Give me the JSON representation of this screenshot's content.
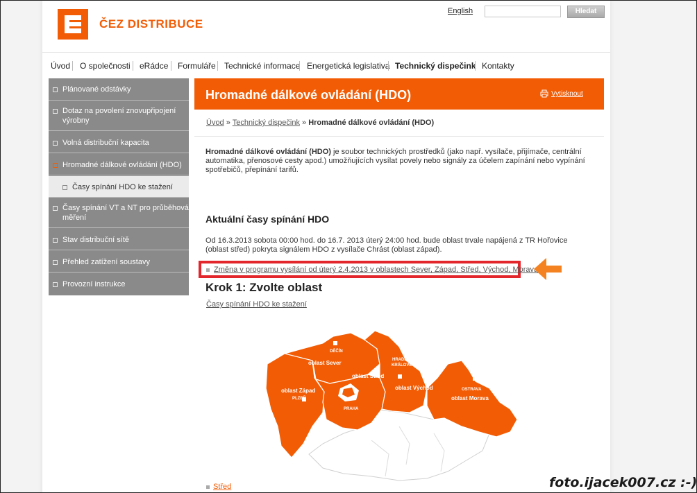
{
  "header": {
    "brand": "ČEZ DISTRIBUCE",
    "english_link": "English",
    "search_placeholder": "",
    "search_button": "Hledat"
  },
  "nav": {
    "items": [
      {
        "label": "Úvod"
      },
      {
        "label": "O společnosti"
      },
      {
        "label": "eRádce"
      },
      {
        "label": "Formuláře"
      },
      {
        "label": "Technické informace"
      },
      {
        "label": "Energetická legislativa"
      },
      {
        "label": "Technický dispečink"
      },
      {
        "label": "Kontakty"
      }
    ],
    "active": "Technický dispečink"
  },
  "sidebar": {
    "items": [
      {
        "label": "Plánované odstávky"
      },
      {
        "label": "Dotaz na povolení znovupřipojení výrobny"
      },
      {
        "label": "Volná distribuční kapacita"
      },
      {
        "label": "Hromadné dálkové ovládání (HDO)"
      },
      {
        "label": "Časy spínání HDO ke stažení"
      },
      {
        "label": "Časy spínání VT a NT pro průběhová měření"
      },
      {
        "label": "Stav distribuční sítě"
      },
      {
        "label": "Přehled zatížení soustavy"
      },
      {
        "label": "Provozní instrukce"
      }
    ]
  },
  "content": {
    "title": "Hromadné dálkové ovládání (HDO)",
    "print_label": "Vytisknout",
    "breadcrumb": {
      "home": "Úvod",
      "sep": "»",
      "section": "Technický dispečink",
      "current": "Hromadné dálkové ovládání (HDO)"
    },
    "intro_bold": "Hromadné dálkové ovládání (HDO)",
    "intro_text": " je soubor technických prostředků (jako např. vysílače, přijímače, centrální automatika, přenosové cesty apod.) umožňujících vysílat povely nebo signály za účelem zapínání nebo vypínání spotřebičů, přepínání tarifů.",
    "section_heading": "Aktuální časy spínání HDO",
    "notice": "Od  16.3.2013 sobota  00:00 hod.  do 16.7. 2013 úterý  24:00 hod. bude oblast  trvale napájená  z TR Hořovice (oblast střed)  pokryta signálem HDO z vysílače Chrást (oblast západ).",
    "change_link": "Změna v programu vysílání od úterý 2.4.2013 v oblastech Sever, Západ, Střed, Východ, Morava",
    "step_heading": "Krok 1: Zvolte oblast",
    "download_link": "Časy spínání HDO ke stažení",
    "region_link": "Střed"
  },
  "map": {
    "regions": {
      "sever": "oblast Sever",
      "zapad": "oblast Západ",
      "stred": "oblast Střed",
      "vychod": "oblast Východ",
      "morava": "oblast Morava"
    },
    "cities": {
      "decin": "DĚČÍN",
      "hradec": "HRADEC",
      "kralove": "KRÁLOVÉ",
      "praha": "PRAHA",
      "plzen": "PLZEŇ",
      "ostrava": "OSTRAVA"
    }
  },
  "watermark": "foto.ijacek007.cz :-)",
  "colors": {
    "brand": "#f25c05",
    "sidebar": "#8a8a8a",
    "highlight": "#e3262c",
    "arrow": "#f58220"
  }
}
